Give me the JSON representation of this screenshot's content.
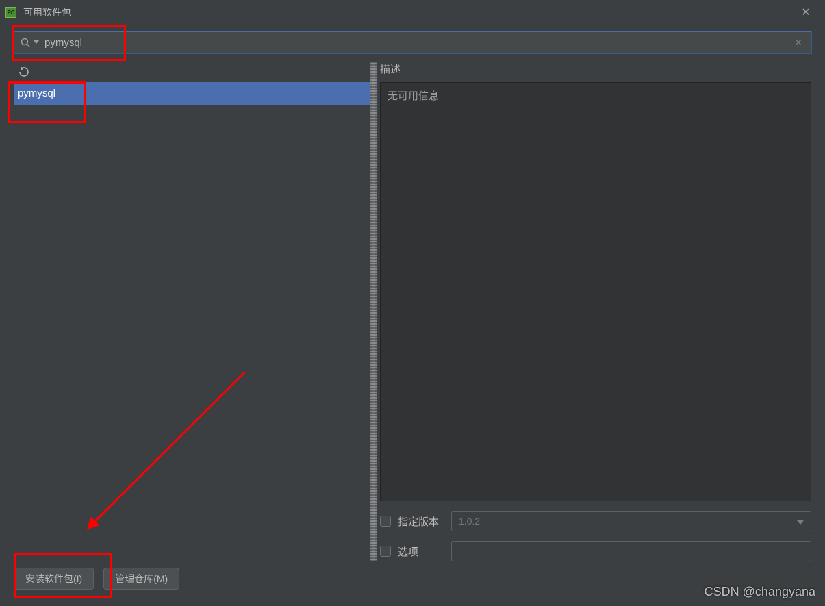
{
  "titlebar": {
    "app_icon_text": "PC",
    "title": "可用软件包",
    "close_glyph": "✕"
  },
  "search": {
    "value": "pymysql",
    "clear_glyph": "✕"
  },
  "left": {
    "packages": [
      {
        "name": "pymysql",
        "selected": true
      }
    ]
  },
  "right": {
    "description_label": "描述",
    "description_body": "无可用信息",
    "specify_version_label": "指定版本",
    "version_value": "1.0.2",
    "options_label": "选项",
    "options_value": ""
  },
  "buttons": {
    "install": "安装软件包(I)",
    "manage_repo": "管理仓库(M)"
  },
  "watermark": "CSDN @changyana"
}
